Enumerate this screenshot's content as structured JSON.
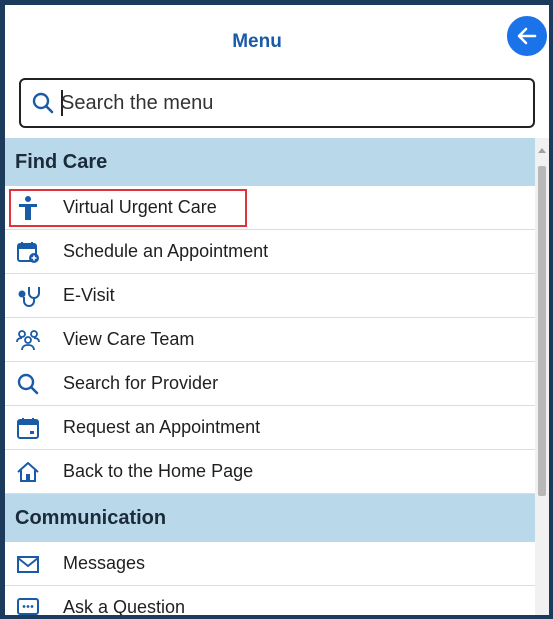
{
  "header": {
    "title": "Menu",
    "back_icon": "arrow-left-icon"
  },
  "search": {
    "placeholder": "Search the menu",
    "value": ""
  },
  "sections": [
    {
      "title": "Find Care",
      "items": [
        {
          "label": "Virtual Urgent Care",
          "icon": "person-icon"
        },
        {
          "label": "Schedule an Appointment",
          "icon": "calendar-add-icon"
        },
        {
          "label": "E-Visit",
          "icon": "stethoscope-icon"
        },
        {
          "label": "View Care Team",
          "icon": "care-team-icon"
        },
        {
          "label": "Search for Provider",
          "icon": "search-icon"
        },
        {
          "label": "Request an Appointment",
          "icon": "calendar-icon"
        },
        {
          "label": "Back to the Home Page",
          "icon": "home-icon"
        }
      ]
    },
    {
      "title": "Communication",
      "items": [
        {
          "label": "Messages",
          "icon": "envelope-icon"
        },
        {
          "label": "Ask a Question",
          "icon": "chat-icon"
        }
      ]
    }
  ],
  "colors": {
    "accent": "#1a73e8",
    "section_bg": "#b9d8ea",
    "title": "#1a5ba8",
    "highlight": "#e0343a",
    "frame": "#1b3a5c"
  }
}
